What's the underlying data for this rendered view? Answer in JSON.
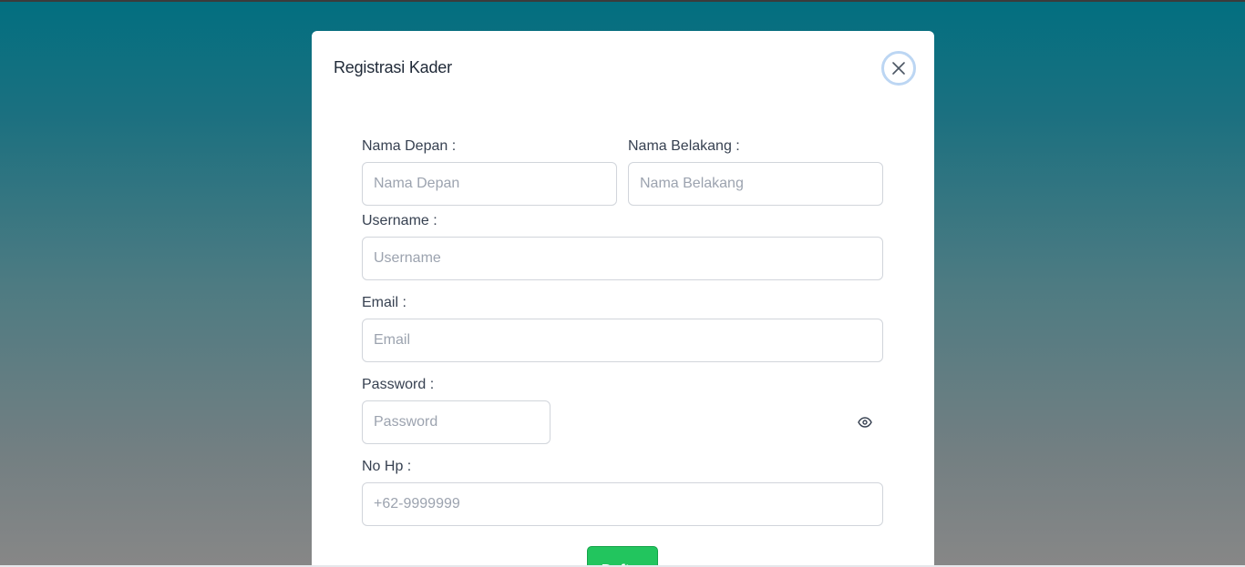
{
  "modal": {
    "title": "Registrasi Kader",
    "close_icon": "close-icon"
  },
  "form": {
    "first_name": {
      "label": "Nama Depan :",
      "placeholder": "Nama Depan",
      "value": ""
    },
    "last_name": {
      "label": "Nama Belakang :",
      "placeholder": "Nama Belakang",
      "value": ""
    },
    "username": {
      "label": "Username :",
      "placeholder": "Username",
      "value": ""
    },
    "email": {
      "label": "Email :",
      "placeholder": "Email",
      "value": ""
    },
    "password": {
      "label": "Password :",
      "placeholder": "Password",
      "value": "",
      "toggle_icon": "eye-icon"
    },
    "phone": {
      "label": "No Hp :",
      "placeholder": "+62-9999999",
      "value": ""
    },
    "submit_label": "Daftar"
  },
  "colors": {
    "background_top": "#026f80",
    "background_bottom": "#878787",
    "submit": "#22c55e",
    "close_ring": "#bcd6f3"
  }
}
